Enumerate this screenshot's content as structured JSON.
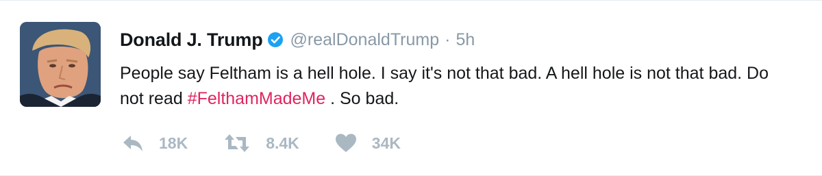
{
  "tweet": {
    "display_name": "Donald J. Trump",
    "handle": "@realDonaldTrump",
    "separator": "·",
    "timestamp": "5h",
    "text_part1": "People say Feltham is a hell hole. I say it's not that bad. A hell hole is not that bad. Do not read ",
    "hashtag": "#FelthamMadeMe",
    "text_part2": " . So bad.",
    "verified_badge": "verified-check-icon"
  },
  "actions": {
    "reply": {
      "icon": "reply-icon",
      "count": "18K"
    },
    "retweet": {
      "icon": "retweet-icon",
      "count": "8.4K"
    },
    "like": {
      "icon": "heart-icon",
      "count": "34K"
    }
  },
  "colors": {
    "name": "#14171a",
    "secondary": "#8899a6",
    "hashtag": "#e0245e",
    "verified": "#1da1f2",
    "action": "#aab8c2"
  }
}
